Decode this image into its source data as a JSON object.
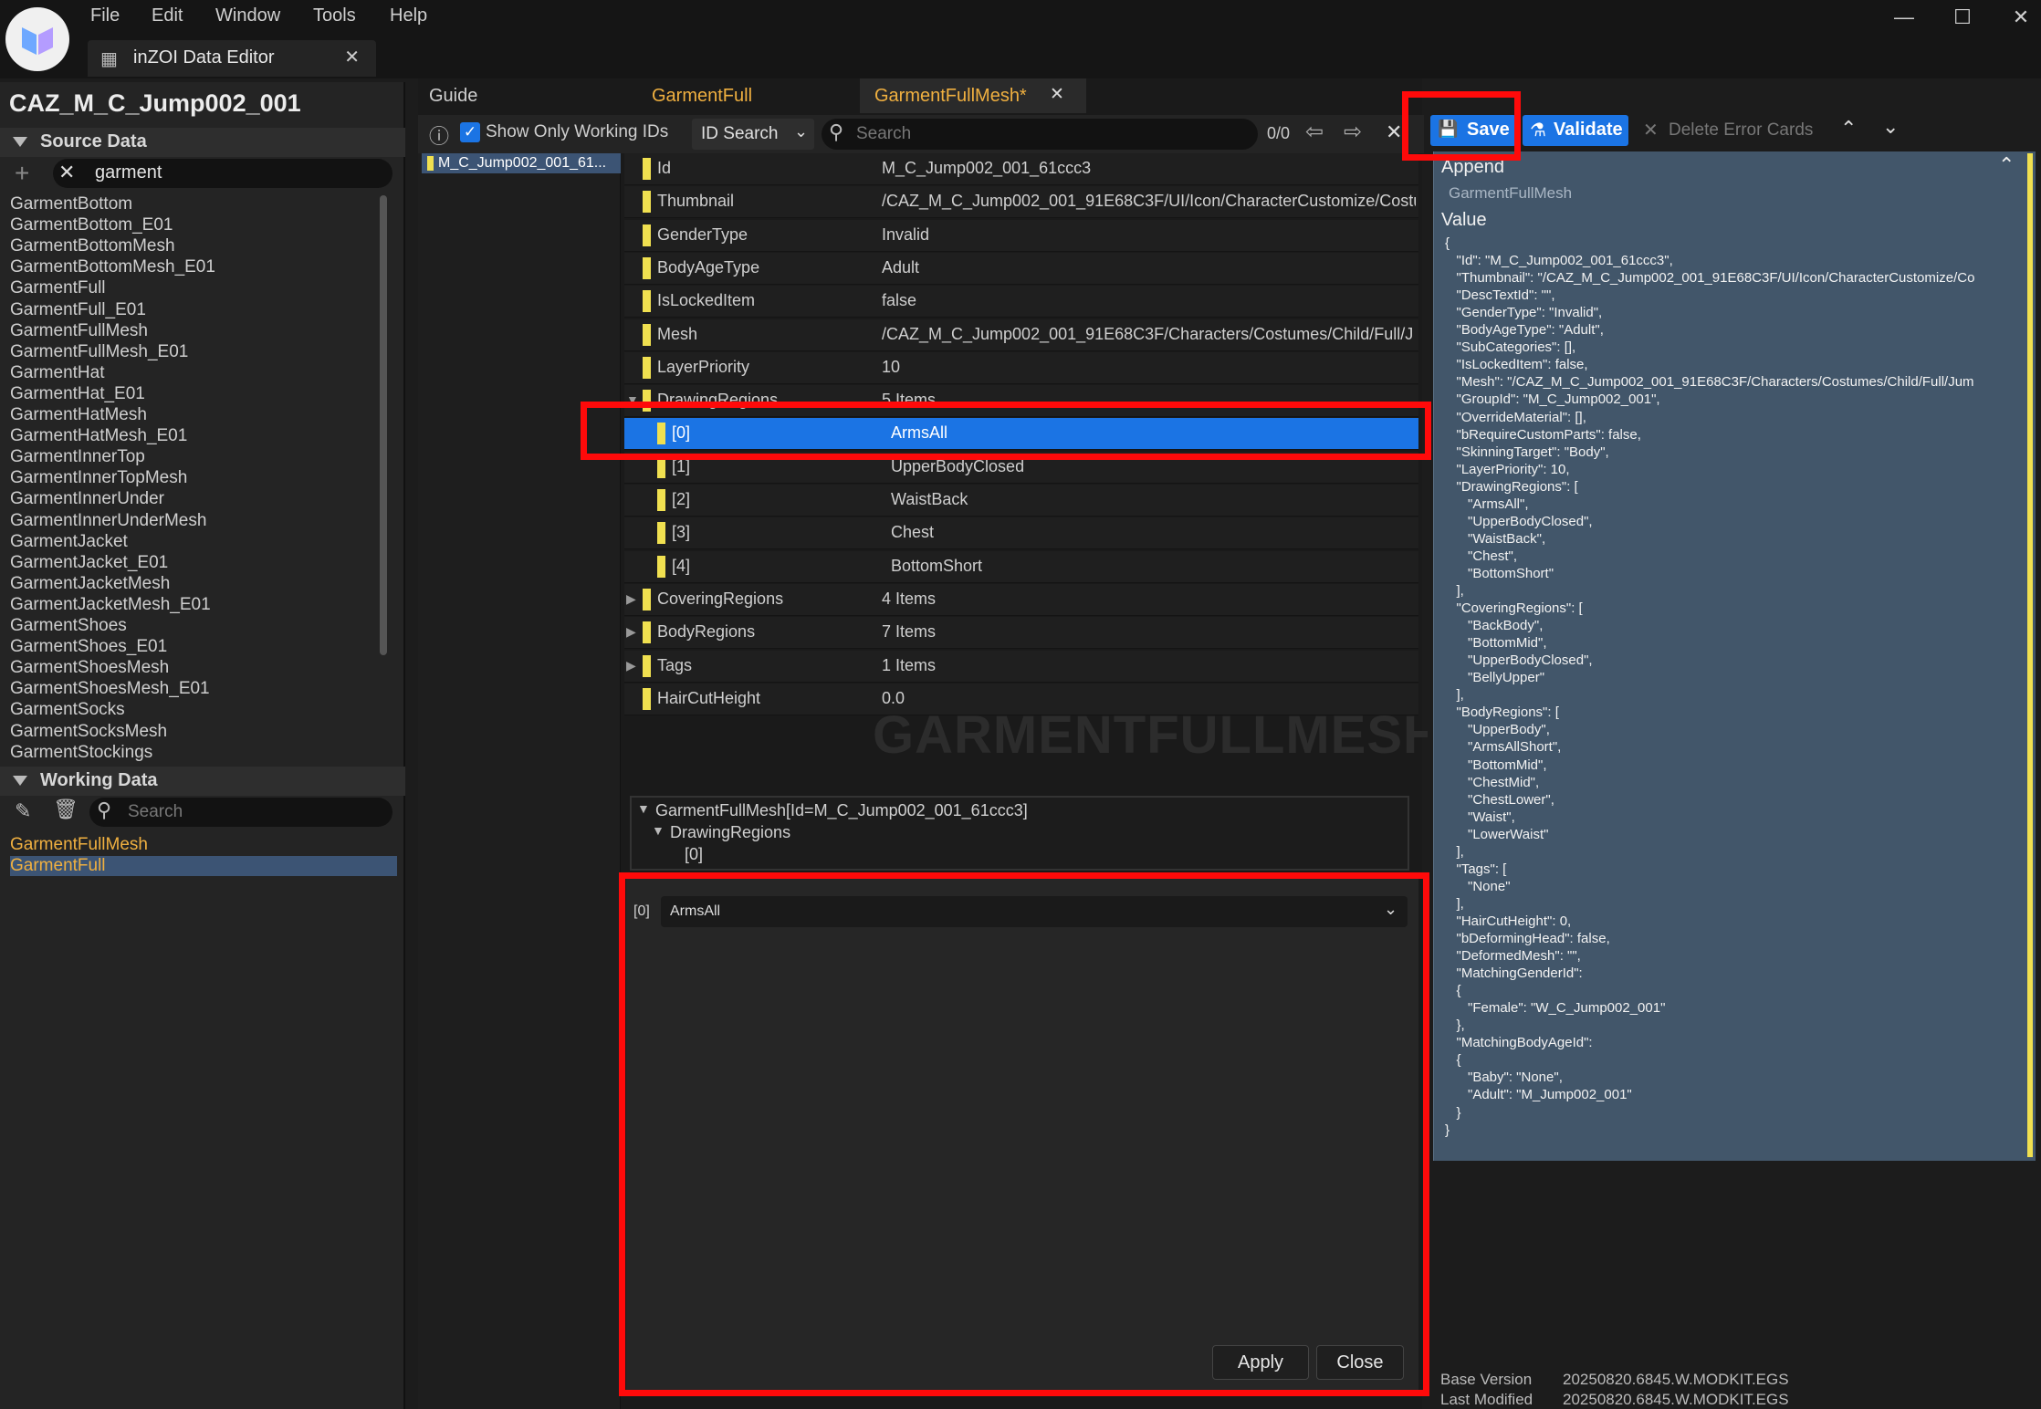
{
  "menu": [
    "File",
    "Edit",
    "Window",
    "Tools",
    "Help"
  ],
  "document_tab": "inZOI Data Editor",
  "asset_title": "CAZ_M_C_Jump002_001",
  "source_data": {
    "header": "Source Data",
    "search_value": "garment",
    "items": [
      "GarmentBottom",
      "GarmentBottom_E01",
      "GarmentBottomMesh",
      "GarmentBottomMesh_E01",
      "GarmentFull",
      "GarmentFull_E01",
      "GarmentFullMesh",
      "GarmentFullMesh_E01",
      "GarmentHat",
      "GarmentHat_E01",
      "GarmentHatMesh",
      "GarmentHatMesh_E01",
      "GarmentInnerTop",
      "GarmentInnerTopMesh",
      "GarmentInnerUnder",
      "GarmentInnerUnderMesh",
      "GarmentJacket",
      "GarmentJacket_E01",
      "GarmentJacketMesh",
      "GarmentJacketMesh_E01",
      "GarmentShoes",
      "GarmentShoes_E01",
      "GarmentShoesMesh",
      "GarmentShoesMesh_E01",
      "GarmentSocks",
      "GarmentSocksMesh",
      "GarmentStockings"
    ]
  },
  "working_data": {
    "header": "Working Data",
    "search_placeholder": "Search",
    "items": [
      "GarmentFullMesh",
      "GarmentFull"
    ]
  },
  "tabs": [
    "Guide",
    "GarmentFull",
    "GarmentFullMesh*"
  ],
  "toolbar": {
    "show_only_working_ids": "Show Only Working IDs",
    "id_search": "ID Search",
    "search_placeholder": "Search",
    "counter": "0/0"
  },
  "id_list": [
    "M_C_Jump002_001_61..."
  ],
  "properties": [
    {
      "key": "Id",
      "value": "M_C_Jump002_001_61ccc3"
    },
    {
      "key": "Thumbnail",
      "value": "/CAZ_M_C_Jump002_001_91E68C3F/UI/Icon/CharacterCustomize/Costu"
    },
    {
      "key": "GenderType",
      "value": "Invalid"
    },
    {
      "key": "BodyAgeType",
      "value": "Adult"
    },
    {
      "key": "IsLockedItem",
      "value": "false"
    },
    {
      "key": "Mesh",
      "value": "/CAZ_M_C_Jump002_001_91E68C3F/Characters/Costumes/Child/Full/J"
    },
    {
      "key": "LayerPriority",
      "value": "10"
    },
    {
      "key": "DrawingRegions",
      "value": "5 Items"
    }
  ],
  "drawing_regions": [
    {
      "key": "[0]",
      "value": "ArmsAll"
    },
    {
      "key": "[1]",
      "value": "UpperBodyClosed"
    },
    {
      "key": "[2]",
      "value": "WaistBack"
    },
    {
      "key": "[3]",
      "value": "Chest"
    },
    {
      "key": "[4]",
      "value": "BottomShort"
    }
  ],
  "properties_after": [
    {
      "key": "CoveringRegions",
      "value": "4 Items"
    },
    {
      "key": "BodyRegions",
      "value": "7 Items"
    },
    {
      "key": "Tags",
      "value": "1 Items"
    },
    {
      "key": "HairCutHeight",
      "value": "0.0"
    }
  ],
  "watermark": "GARMENTFULLMESH",
  "path_tree": {
    "root": "GarmentFullMesh[Id=M_C_Jump002_001_61ccc3]",
    "child": "DrawingRegions",
    "leaf": "[0]"
  },
  "editor": {
    "index": "[0]",
    "selected": "ArmsAll",
    "apply": "Apply",
    "close": "Close"
  },
  "right_toolbar": {
    "save": "Save",
    "validate": "Validate",
    "delete": "Delete Error Cards"
  },
  "json_panel": {
    "append": "Append",
    "sub": "GarmentFullMesh",
    "value_label": "Value",
    "lines": [
      "{",
      "   \"Id\": \"M_C_Jump002_001_61ccc3\",",
      "   \"Thumbnail\": \"/CAZ_M_C_Jump002_001_91E68C3F/UI/Icon/CharacterCustomize/Co",
      "   \"DescTextId\": \"\",",
      "   \"GenderType\": \"Invalid\",",
      "   \"BodyAgeType\": \"Adult\",",
      "   \"SubCategories\": [],",
      "   \"IsLockedItem\": false,",
      "   \"Mesh\": \"/CAZ_M_C_Jump002_001_91E68C3F/Characters/Costumes/Child/Full/Jum",
      "   \"GroupId\": \"M_C_Jump002_001\",",
      "   \"OverrideMaterial\": [],",
      "   \"bRequireCustomParts\": false,",
      "   \"SkinningTarget\": \"Body\",",
      "   \"LayerPriority\": 10,",
      "   \"DrawingRegions\": [",
      "      \"ArmsAll\",",
      "      \"UpperBodyClosed\",",
      "      \"WaistBack\",",
      "      \"Chest\",",
      "      \"BottomShort\"",
      "   ],",
      "   \"CoveringRegions\": [",
      "      \"BackBody\",",
      "      \"BottomMid\",",
      "      \"UpperBodyClosed\",",
      "      \"BellyUpper\"",
      "   ],",
      "   \"BodyRegions\": [",
      "      \"UpperBody\",",
      "      \"ArmsAllShort\",",
      "      \"BottomMid\",",
      "      \"ChestMid\",",
      "      \"ChestLower\",",
      "      \"Waist\",",
      "      \"LowerWaist\"",
      "   ],",
      "   \"Tags\": [",
      "      \"None\"",
      "   ],",
      "   \"HairCutHeight\": 0,",
      "   \"bDeformingHead\": false,",
      "   \"DeformedMesh\": \"\",",
      "   \"MatchingGenderId\":",
      "   {",
      "      \"Female\": \"W_C_Jump002_001\"",
      "   },",
      "   \"MatchingBodyAgeId\":",
      "   {",
      "      \"Baby\": \"None\",",
      "      \"Adult\": \"M_Jump002_001\"",
      "   }",
      "}"
    ]
  },
  "footer": {
    "base_version_label": "Base Version",
    "base_version": "20250820.6845.W.MODKIT.EGS",
    "last_modified_label": "Last Modified",
    "last_modified": "20250820.6845.W.MODKIT.EGS"
  },
  "colors": {
    "accent_blue": "#1b74e4",
    "highlight": "#ff0a0a",
    "tab_active": "#f0b040"
  }
}
